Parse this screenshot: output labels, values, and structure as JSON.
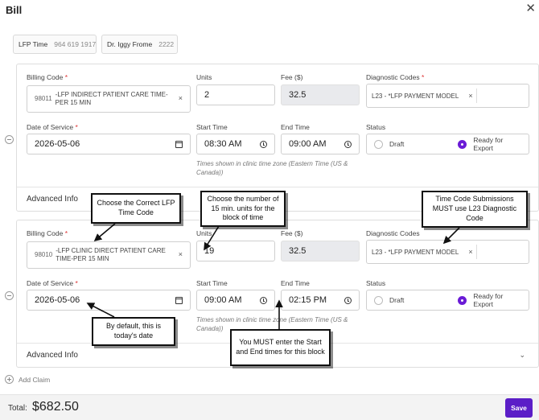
{
  "title": "Bill",
  "header_chips": [
    {
      "name": "LFP Time",
      "number": "964 619 1917"
    },
    {
      "name": "Dr. Iggy Frome",
      "number": "2222"
    }
  ],
  "labels": {
    "billing_code": "Billing Code",
    "units": "Units",
    "fee": "Fee ($)",
    "diagnostic_codes": "Diagnostic Codes",
    "date_of_service": "Date of Service",
    "start_time": "Start Time",
    "end_time": "End Time",
    "status": "Status",
    "required_marker": "*",
    "advanced_info": "Advanced Info",
    "timezone_note": "Times shown in clinic time zone (Eastern Time (US & Canada))",
    "status_draft": "Draft",
    "status_ready": "Ready for Export"
  },
  "claims": [
    {
      "billing_code_num": "98011",
      "billing_code_desc": "-LFP INDIRECT PATIENT CARE TIME-PER 15 MIN",
      "units": "2",
      "fee": "32.5",
      "diagnostic_code": "L23 - *LFP PAYMENT MODEL",
      "date_of_service": "2026-05-06",
      "start_time": "08:30 AM",
      "end_time": "09:00 AM",
      "status": "Ready for Export"
    },
    {
      "billing_code_num": "98010",
      "billing_code_desc": "-LFP CLINIC DIRECT PATIENT CARE TIME-PER 15 MIN",
      "units": "19",
      "fee": "32.5",
      "diagnostic_code": "L23 - *LFP PAYMENT MODEL",
      "date_of_service": "2026-05-06",
      "start_time": "09:00 AM",
      "end_time": "02:15 PM",
      "status": "Ready for Export"
    }
  ],
  "callouts": {
    "time_code": "Choose the Correct LFP Time Code",
    "units": "Choose the number of 15 min. units for the block of time",
    "diagnostic": "Time Code Submissions MUST use L23 Diagnostic Code",
    "date": "By default, this is today's date",
    "times": "You MUST enter the Start and End times for this block"
  },
  "add_claim": "Add Claim",
  "footer": {
    "total_label": "Total:",
    "total_value": "$682.50",
    "save_label": "Save"
  },
  "colors": {
    "accent": "#5b1ec7",
    "radio_selected": "#6a1bd6"
  },
  "icons": [
    "close-icon",
    "calendar-icon",
    "clock-icon",
    "remove-claim-icon",
    "add-claim-icon",
    "chevron-down-icon",
    "clear-x-icon"
  ]
}
